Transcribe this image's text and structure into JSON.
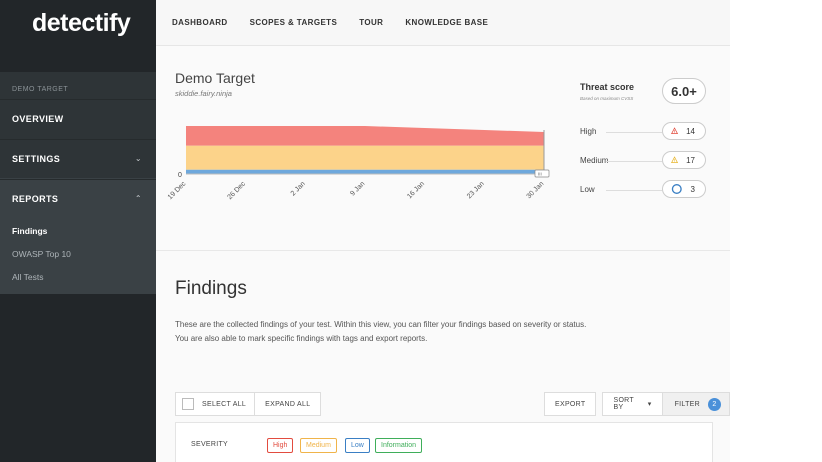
{
  "app": {
    "logo": "detectify"
  },
  "sidebar": {
    "section_label": "DEMO TARGET",
    "items": [
      {
        "label": "OVERVIEW"
      },
      {
        "label": "SETTINGS",
        "chevron": "⌄"
      },
      {
        "label": "REPORTS",
        "chevron": "⌃"
      }
    ],
    "sub_items": [
      {
        "label": "Findings"
      },
      {
        "label": "OWASP Top 10"
      },
      {
        "label": "All Tests"
      }
    ]
  },
  "topnav": {
    "items": [
      {
        "label": "DASHBOARD"
      },
      {
        "label": "SCOPES & TARGETS"
      },
      {
        "label": "TOUR"
      },
      {
        "label": "KNOWLEDGE BASE"
      }
    ]
  },
  "target": {
    "title": "Demo Target",
    "subtitle": "skiddie.fairy.ninja"
  },
  "chart_data": {
    "type": "area",
    "x": [
      "19 Dec",
      "26 Dec",
      "2 Jan",
      "9 Jan",
      "16 Jan",
      "23 Jan",
      "30 Jan"
    ],
    "y_zero_label": "0",
    "end_marker": "III",
    "series": [
      {
        "name": "High",
        "values": [
          14,
          14,
          14,
          14,
          14,
          14,
          14
        ],
        "color": "#f4837d"
      },
      {
        "name": "Medium",
        "values": [
          17,
          17,
          17,
          17,
          17,
          17,
          17
        ],
        "color": "#fcd38a"
      },
      {
        "name": "Low",
        "values": [
          3,
          3,
          3,
          3,
          3,
          3,
          3
        ],
        "color": "#6ea8dc"
      }
    ]
  },
  "threat": {
    "title": "Threat score",
    "subtitle": "Based on maximum CVSS",
    "score": "6.0+",
    "levels": [
      {
        "label": "High",
        "count": "14",
        "color": "#e24c3f",
        "icon": "warning-triangle-icon"
      },
      {
        "label": "Medium",
        "count": "17",
        "color": "#e8b62e",
        "icon": "warning-triangle-icon"
      },
      {
        "label": "Low",
        "count": "3",
        "color": "#3a7fc4",
        "icon": "circle-icon"
      }
    ]
  },
  "findings": {
    "title": "Findings",
    "description": "These are the collected findings of your test. Within this view, you can filter your findings based on severity or status. You are also able to mark specific findings with tags and export reports."
  },
  "toolbar": {
    "select_all": "SELECT ALL",
    "expand_all": "EXPAND ALL",
    "export": "EXPORT",
    "sort_by": "SORT BY",
    "sort_caret": "▾",
    "filter": "FILTER",
    "filter_count": "2"
  },
  "severity_filter": {
    "label": "SEVERITY",
    "tags": [
      {
        "label": "High",
        "color": "#e24c3f"
      },
      {
        "label": "Medium",
        "color": "#f0b44a"
      },
      {
        "label": "Low",
        "color": "#3a7fc4"
      },
      {
        "label": "Information",
        "color": "#3fae5a"
      }
    ]
  }
}
